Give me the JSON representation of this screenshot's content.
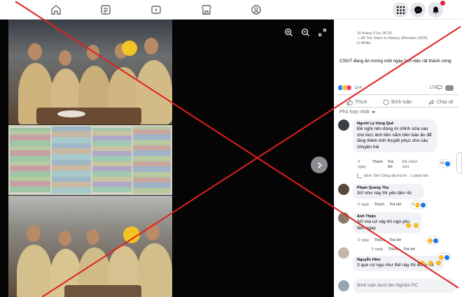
{
  "nav": {
    "icons": [
      "home-icon",
      "news-icon",
      "video-icon",
      "marketplace-icon",
      "groups-icon"
    ],
    "right_icons": [
      "menu-grid-icon",
      "messenger-icon",
      "notifications-icon"
    ]
  },
  "post": {
    "time": "10 tháng 3 lúc 06:33",
    "song": "♫ All The Stars Is History (Remake 2025)",
    "song_artist": "D.White",
    "caption": "CSGT đang ăn mừng một ngày làm việc rất thành công",
    "reaction_count": "114",
    "comment_count": "179",
    "actions": {
      "like": "Thích",
      "comment": "Bình luận",
      "share": "Chia sẻ"
    },
    "sort_label": "Phù hợp nhất"
  },
  "comments": [
    {
      "name": "Người Lạ Vùng Quê",
      "text": "Đề nghị nên dùng AI chỉnh sửa sao cho bức ảnh tiền nằm trên bàn ăn để tăng thêm tính thuyết phục cho câu chuyện hài",
      "time": "4 ngày",
      "like": "Thích",
      "reply": "Trả lời",
      "edited": "Đã chỉnh sửa",
      "reactions": "69",
      "reply_summary": "Đinh Tiến Dũng đã trả lời · 1 phản hồi"
    },
    {
      "name": "Phạm Quang Thọ",
      "text": "3/// như này thì yên tâm rồi",
      "time": "5 ngày",
      "like": "Thích",
      "reply": "Trả lời",
      "reactions": "6"
    },
    {
      "name": "Anh Thiện",
      "text": "3/// mà cứ vậy thì ngủ yên tâm ngay",
      "time": "5 ngày",
      "like": "Thích",
      "reply": "Trả lời"
    },
    {
      "name": "Nguyễn Hiền",
      "text": "3 que cứ ngu như thế này thì đỡ lo rồi",
      "time": "5 ngày",
      "like": "Thích",
      "reply": "Trả lời"
    }
  ],
  "composer": {
    "placeholder": "Bình luận dưới tên Nghiện PC"
  },
  "colors": {
    "accent": "#1877f2",
    "overlay_x": "#e02020",
    "viewer_bg": "#050505"
  }
}
